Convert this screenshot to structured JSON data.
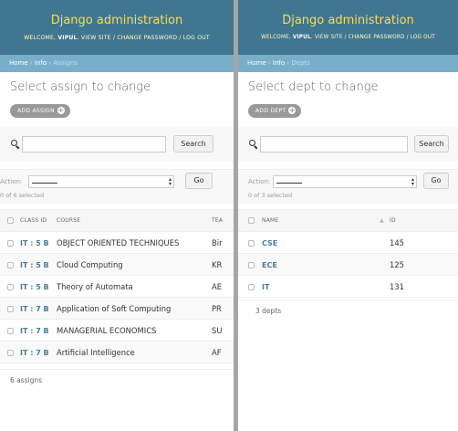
{
  "left": {
    "header": {
      "branding": "Django administration",
      "welcome_prefix": "WELCOME, ",
      "user": "VIPUL",
      "view_site": "VIEW SITE",
      "change_password": "CHANGE PASSWORD",
      "log_out": "LOG OUT",
      "sep": " / "
    },
    "breadcrumbs": {
      "home": "Home",
      "app": "Info",
      "current": "Assigns",
      "sep": " › "
    },
    "title": "Select assign to change",
    "add_button": "ADD ASSIGN",
    "search": {
      "value": "",
      "button": "Search"
    },
    "actions": {
      "label": "Action:",
      "selected": "———",
      "go": "Go",
      "count": "0 of 6 selected"
    },
    "columns": [
      "CLASS ID",
      "COURSE",
      "TEA"
    ],
    "rows": [
      {
        "class_id": "IT : 5 B",
        "course": "OBJECT ORIENTED TECHNIQUES",
        "teacher": "Bir"
      },
      {
        "class_id": "IT : 5 B",
        "course": "Cloud Computing",
        "teacher": "KR"
      },
      {
        "class_id": "IT : 5 B",
        "course": "Theory of Automata",
        "teacher": "AE"
      },
      {
        "class_id": "IT : 7 B",
        "course": "Application of Soft Computing",
        "teacher": "PR"
      },
      {
        "class_id": "IT : 7 B",
        "course": "MANAGERIAL ECONOMICS",
        "teacher": "SU"
      },
      {
        "class_id": "IT : 7 B",
        "course": "Artificial Intelligence",
        "teacher": "AF"
      }
    ],
    "paginator": "6 assigns"
  },
  "right": {
    "header": {
      "branding": "Django administration",
      "welcome_prefix": "WELCOME, ",
      "user": "VIPUL",
      "view_site": "VIEW SITE",
      "change_password": "CHANGE PASSWORD",
      "log_out": "LOG OUT",
      "sep": " / "
    },
    "breadcrumbs": {
      "home": "Home",
      "app": "Info",
      "current": "Depts",
      "sep": " › "
    },
    "title": "Select dept to change",
    "add_button": "ADD DEPT",
    "search": {
      "value": "",
      "button": "Search"
    },
    "actions": {
      "label": "Action:",
      "selected": "———",
      "go": "Go",
      "count": "0 of 3 selected"
    },
    "columns": [
      "NAME",
      "ID"
    ],
    "rows": [
      {
        "name": "CSE",
        "id": "145"
      },
      {
        "name": "ECE",
        "id": "125"
      },
      {
        "name": "IT",
        "id": "131"
      }
    ],
    "paginator": "3 depts"
  },
  "icons": {
    "search": "search-icon",
    "add": "plus-icon",
    "select": "select-arrows-icon",
    "sort": "sort-ascending-icon"
  },
  "colors": {
    "header": "#417690",
    "breadcrumbs": "#79aec8",
    "branding": "#f5dd5d",
    "link": "#447e9b"
  }
}
